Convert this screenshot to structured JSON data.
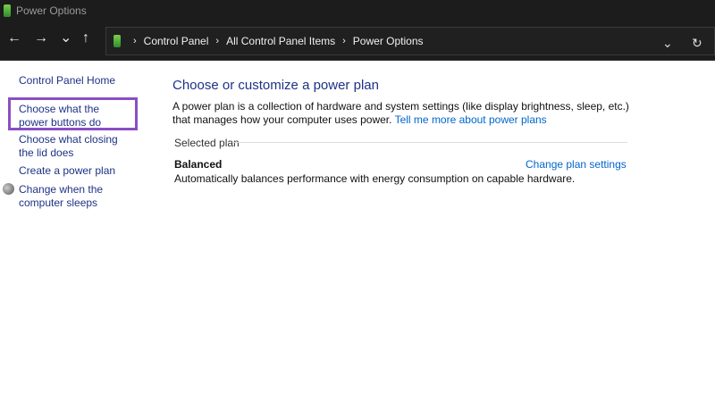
{
  "window": {
    "title": "Power Options"
  },
  "nav": {
    "back": "←",
    "forward": "→",
    "recent": "⌄",
    "up": "↑"
  },
  "address": {
    "crumbs": [
      "Control Panel",
      "All Control Panel Items",
      "Power Options"
    ],
    "dropdown": "⌄",
    "refresh": "↻"
  },
  "sidebar": {
    "items": [
      "Control Panel Home",
      "Choose what the power buttons do",
      "Choose what closing the lid does",
      "Create a power plan",
      "Change when the computer sleeps"
    ]
  },
  "main": {
    "title": "Choose or customize a power plan",
    "description": "A power plan is a collection of hardware and system settings (like display brightness, sleep, etc.) that manages how your computer uses power.",
    "learn_link": "Tell me more about power plans",
    "selected_plan_label": "Selected plan",
    "plan_name": "Balanced",
    "change_settings": "Change plan settings",
    "plan_description": "Automatically balances performance with energy consumption on capable hardware."
  },
  "colors": {
    "highlight": "#8a4fc4",
    "link": "#0066cc",
    "nav_link": "#1e3287"
  }
}
